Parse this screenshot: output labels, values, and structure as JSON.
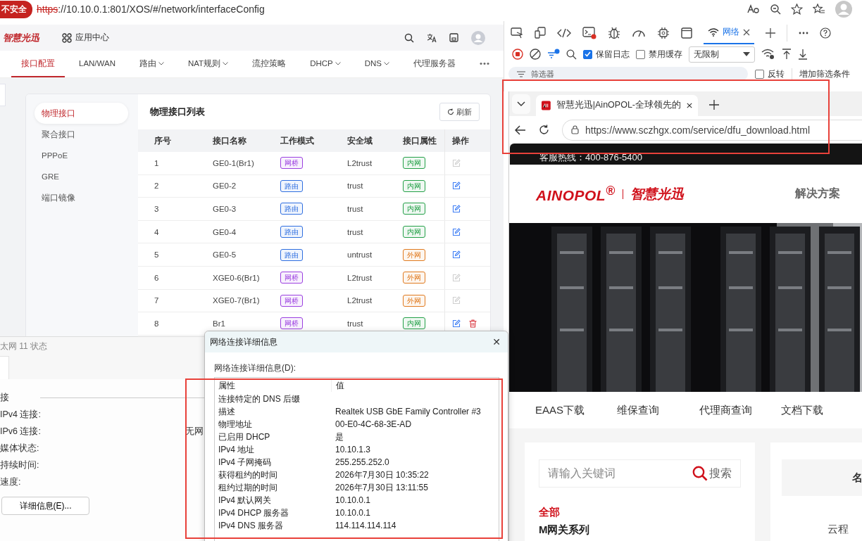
{
  "address_bar": {
    "security": "不安全",
    "url_scheme": "https",
    "url_rest": "://10.10.0.1:801/XOS/#/network/interfaceConfig"
  },
  "app": {
    "logo": "智慧光迅",
    "app_center": "应用中心",
    "tabs": [
      {
        "label": "接口配置",
        "selected": true,
        "dropdown": false
      },
      {
        "label": "LAN/WAN",
        "selected": false,
        "dropdown": false
      },
      {
        "label": "路由",
        "selected": false,
        "dropdown": true
      },
      {
        "label": "NAT规则",
        "selected": false,
        "dropdown": true
      },
      {
        "label": "流控策略",
        "selected": false,
        "dropdown": false
      },
      {
        "label": "DHCP",
        "selected": false,
        "dropdown": true
      },
      {
        "label": "DNS",
        "selected": false,
        "dropdown": true
      },
      {
        "label": "代理服务器",
        "selected": false,
        "dropdown": false
      }
    ],
    "more": "•••",
    "sidebar": [
      {
        "label": "物理接口",
        "selected": true
      },
      {
        "label": "聚合接口",
        "selected": false
      },
      {
        "label": "PPPoE",
        "selected": false
      },
      {
        "label": "GRE",
        "selected": false
      },
      {
        "label": "端口镜像",
        "selected": false
      }
    ],
    "panel_title": "物理接口列表",
    "refresh": "刷新",
    "table": {
      "columns": [
        "序号",
        "接口名称",
        "工作模式",
        "安全域",
        "接口属性",
        "操作"
      ],
      "rows": [
        {
          "index": "1",
          "name": "GE0-1(Br1)",
          "mode": {
            "text": "网桥",
            "color": "#9b3fe0"
          },
          "zone": "L2trust",
          "attr": {
            "text": "内网",
            "color": "#23a047"
          },
          "editable": false,
          "deletable": false
        },
        {
          "index": "2",
          "name": "GE0-2",
          "mode": {
            "text": "路由",
            "color": "#2f6fe0"
          },
          "zone": "trust",
          "attr": {
            "text": "内网",
            "color": "#23a047"
          },
          "editable": true,
          "deletable": false
        },
        {
          "index": "3",
          "name": "GE0-3",
          "mode": {
            "text": "路由",
            "color": "#2f6fe0"
          },
          "zone": "trust",
          "attr": {
            "text": "内网",
            "color": "#23a047"
          },
          "editable": true,
          "deletable": false
        },
        {
          "index": "4",
          "name": "GE0-4",
          "mode": {
            "text": "路由",
            "color": "#2f6fe0"
          },
          "zone": "trust",
          "attr": {
            "text": "内网",
            "color": "#23a047"
          },
          "editable": true,
          "deletable": false
        },
        {
          "index": "5",
          "name": "GE0-5",
          "mode": {
            "text": "路由",
            "color": "#2f6fe0"
          },
          "zone": "untrust",
          "attr": {
            "text": "外网",
            "color": "#e07a1f"
          },
          "editable": true,
          "deletable": false
        },
        {
          "index": "6",
          "name": "XGE0-6(Br1)",
          "mode": {
            "text": "网桥",
            "color": "#9b3fe0"
          },
          "zone": "L2trust",
          "attr": {
            "text": "外网",
            "color": "#e07a1f"
          },
          "editable": false,
          "deletable": false
        },
        {
          "index": "7",
          "name": "XGE0-7(Br1)",
          "mode": {
            "text": "网桥",
            "color": "#9b3fe0"
          },
          "zone": "L2trust",
          "attr": {
            "text": "外网",
            "color": "#e07a1f"
          },
          "editable": false,
          "deletable": false
        },
        {
          "index": "8",
          "name": "Br1",
          "mode": {
            "text": "网桥",
            "color": "#9b3fe0"
          },
          "zone": "trust",
          "attr": {
            "text": "内网",
            "color": "#23a047"
          },
          "editable": true,
          "deletable": true
        }
      ]
    }
  },
  "devtools": {
    "tabs": [
      {
        "label": "网络",
        "selected": true
      }
    ],
    "preserve_log": {
      "label": "保留日志",
      "checked": true
    },
    "disable_cache": {
      "label": "禁用缓存",
      "checked": false
    },
    "throttle": "无限制",
    "filter_placeholder": "筛选器",
    "invert": {
      "label": "反转",
      "checked": false
    },
    "add_filter": "增加筛选条件"
  },
  "site_browser": {
    "tab_title": "智慧光迅|AinOPOL-全球领先的",
    "url": "https://www.sczhgx.com/service/dfu_download.html",
    "hotline": "客服热线：400-876-5400",
    "logo_latin": "AINOPOL$^{®}$",
    "logo_cn": "智慧光迅",
    "nav_item": "解决方案",
    "subnav": [
      "EAAS下载",
      "维保查询",
      "代理商查询",
      "文档下载"
    ],
    "search_placeholder": "请输入关键词",
    "search_button": "搜索",
    "categories": [
      {
        "label": "全部",
        "selected": true
      },
      {
        "label": "M网关系列",
        "selected": false
      }
    ],
    "right_heading": "名",
    "right_item": "云程"
  },
  "status_dialog": {
    "title": "太网 11 状态",
    "group": "接",
    "rows": [
      {
        "label": "IPv4 连接:"
      },
      {
        "label": "IPv6 连接:",
        "value": "无网"
      },
      {
        "label": "媒体状态:"
      },
      {
        "label": "持续时间:"
      },
      {
        "label": "速度:"
      }
    ],
    "details_button": "详细信息(E)..."
  },
  "details_dialog": {
    "title": "网络连接详细信息",
    "close": "✕",
    "list_label": "网络连接详细信息(D):",
    "columns": [
      "属性",
      "值"
    ],
    "rows": [
      {
        "property": "连接特定的 DNS 后缀"
      },
      {
        "property": "描述",
        "value": "Realtek USB GbE Family Controller #3"
      },
      {
        "property": "物理地址",
        "value": "00-E0-4C-68-3E-AD"
      },
      {
        "property": "已启用 DHCP",
        "value": "是"
      },
      {
        "property": "IPv4 地址",
        "value": "10.10.1.3"
      },
      {
        "property": "IPv4 子网掩码",
        "value": "255.255.252.0"
      },
      {
        "property": "获得租约的时间",
        "value": "2026年7月30日 10:35:22"
      },
      {
        "property": "租约过期的时间",
        "value": "2026年7月30日 13:11:55"
      },
      {
        "property": "IPv4 默认网关",
        "value": "10.10.0.1"
      },
      {
        "property": "IPv4 DHCP 服务器",
        "value": "10.10.0.1"
      },
      {
        "property": "IPv4 DNS 服务器",
        "value": "114.114.114.114"
      }
    ]
  }
}
